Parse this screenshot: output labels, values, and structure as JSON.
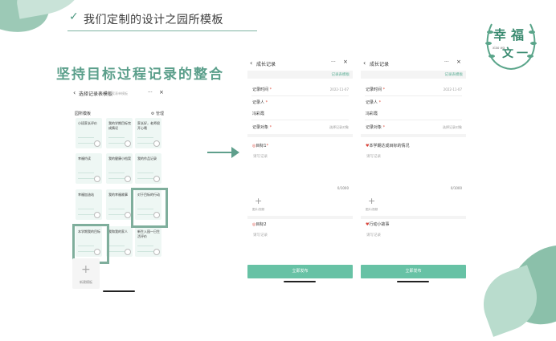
{
  "header": {
    "title": "我们定制的设计之园所模板",
    "check_icon": "check-icon"
  },
  "headline": "坚持目标过程记录的整合",
  "logo": {
    "chars": [
      "幸",
      "福",
      "文",
      "一"
    ],
    "small": "xiao wa"
  },
  "colors": {
    "accent": "#5b9f8b",
    "button": "#67c2a5",
    "card": "#eef7f4"
  },
  "phone1": {
    "title": "选择记录表模板",
    "search_placeholder": "搜索表单模板",
    "section": "园所模板",
    "manage": "管理",
    "cards": [
      "小班家长评价",
      "我的学期目标完成情况",
      "家长好，老师很开心哦",
      "幸福约读",
      "我的健康小档案",
      "我的作品记录",
      "幸福加油站",
      "我的幸福故事",
      "对于目标的行动",
      "本学期我的目标",
      "我和我的家人",
      "新生入园一日生活评价"
    ],
    "new_template": "新建模板"
  },
  "form2": {
    "title": "成长记录",
    "template_label": "记录表模板",
    "time_label": "记录时间",
    "time_value": "2022-11-07",
    "person_label": "记录人",
    "person_value": "冯彩霞",
    "object_label": "记录对象",
    "object_value": "选择记录对象",
    "goal1_label": "目标1",
    "placeholder": "请写记录",
    "count": "0/1000",
    "add_image": "图片/视频",
    "goal2_label": "目标2",
    "submit": "立即发布"
  },
  "form3": {
    "title": "成长记录",
    "template_label": "记录表模板",
    "time_label": "记录时间",
    "time_value": "2022-11-07",
    "person_label": "记录人",
    "person_value": "冯彩霞",
    "object_label": "记录对象",
    "object_value": "选择记录对象",
    "q1_label": "本学期达成目标的情况",
    "placeholder": "请写记录",
    "count": "0/1000",
    "add_image": "图片/视频",
    "q2_label": "行动小故事",
    "submit": "立即发布"
  }
}
